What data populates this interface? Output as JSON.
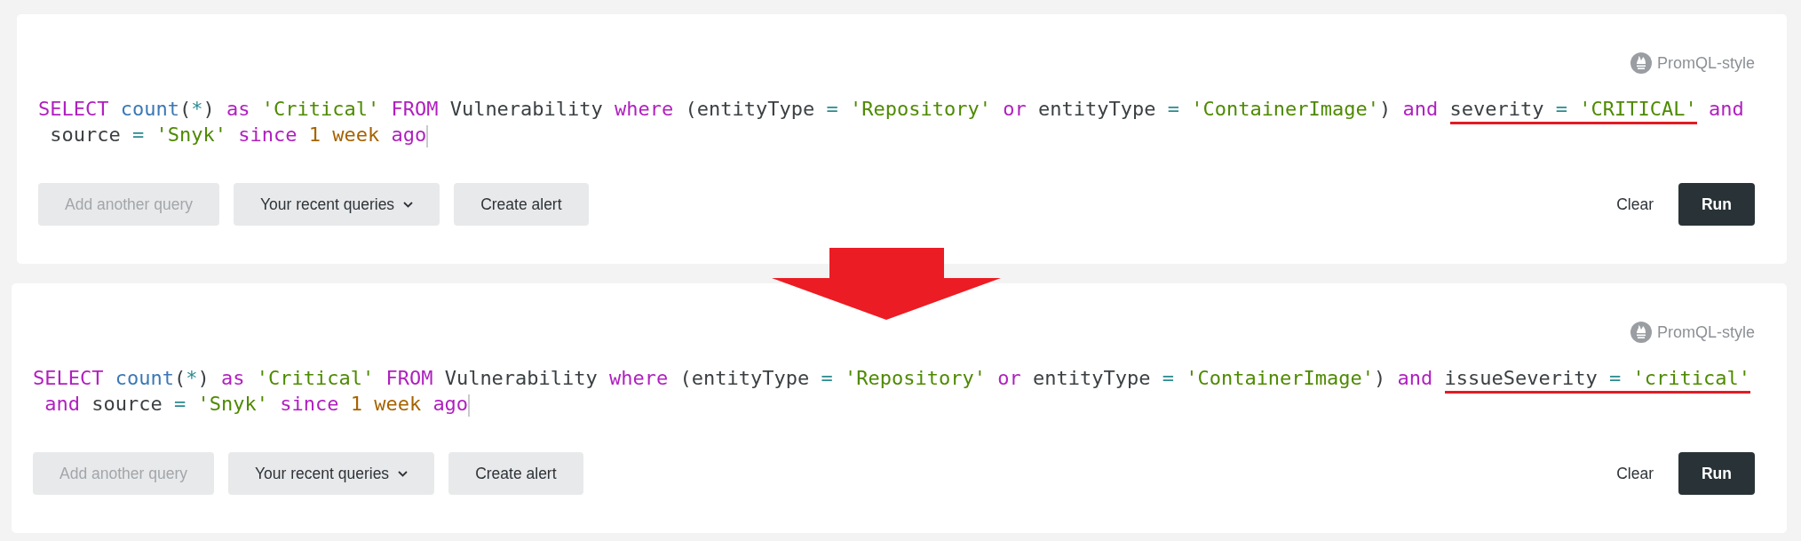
{
  "panels": [
    {
      "badge": "PromQL-style",
      "query_lines": [
        [
          {
            "kind": "keyword",
            "text": "SELECT ",
            "underlined": false
          },
          {
            "kind": "function",
            "text": "count",
            "underlined": false
          },
          {
            "kind": "plain",
            "text": "(",
            "underlined": false
          },
          {
            "kind": "operator",
            "text": "*",
            "underlined": false
          },
          {
            "kind": "plain",
            "text": ") ",
            "underlined": false
          },
          {
            "kind": "keyword",
            "text": "as ",
            "underlined": false
          },
          {
            "kind": "string",
            "text": "'Critical' ",
            "underlined": false
          },
          {
            "kind": "keyword",
            "text": "FROM ",
            "underlined": false
          },
          {
            "kind": "plain",
            "text": "Vulnerability ",
            "underlined": false
          },
          {
            "kind": "keyword",
            "text": "where ",
            "underlined": false
          },
          {
            "kind": "plain",
            "text": "(entityType ",
            "underlined": false
          },
          {
            "kind": "operator",
            "text": "= ",
            "underlined": false
          },
          {
            "kind": "string",
            "text": "'Repository' ",
            "underlined": false
          },
          {
            "kind": "keyword",
            "text": "or ",
            "underlined": false
          },
          {
            "kind": "plain",
            "text": "entityType ",
            "underlined": false
          },
          {
            "kind": "operator",
            "text": "= ",
            "underlined": false
          },
          {
            "kind": "string",
            "text": "'ContainerImage'",
            "underlined": false
          },
          {
            "kind": "plain",
            "text": ") ",
            "underlined": false
          },
          {
            "kind": "keyword",
            "text": "and ",
            "underlined": false
          },
          {
            "kind": "plain",
            "text": "severity ",
            "underlined": true
          },
          {
            "kind": "operator",
            "text": "= ",
            "underlined": true
          },
          {
            "kind": "string",
            "text": "'CRITICAL'",
            "underlined": true
          },
          {
            "kind": "keyword",
            "text": " and",
            "underlined": false
          }
        ],
        [
          {
            "kind": "plain",
            "text": " source ",
            "underlined": false
          },
          {
            "kind": "operator",
            "text": "= ",
            "underlined": false
          },
          {
            "kind": "string",
            "text": "'Snyk' ",
            "underlined": false
          },
          {
            "kind": "keyword",
            "text": "since ",
            "underlined": false
          },
          {
            "kind": "number",
            "text": "1 week ",
            "underlined": false
          },
          {
            "kind": "keyword",
            "text": "ago",
            "underlined": false
          }
        ]
      ],
      "buttons": [
        {
          "kind": "plain",
          "label": "Add another query",
          "disabled": true
        },
        {
          "kind": "dropdown",
          "label": "Your recent queries",
          "disabled": false
        },
        {
          "kind": "plain",
          "label": "Create alert",
          "disabled": false
        }
      ],
      "clear": "Clear",
      "run": "Run"
    },
    {
      "badge": "PromQL-style",
      "query_lines": [
        [
          {
            "kind": "keyword",
            "text": "SELECT ",
            "underlined": false
          },
          {
            "kind": "function",
            "text": "count",
            "underlined": false
          },
          {
            "kind": "plain",
            "text": "(",
            "underlined": false
          },
          {
            "kind": "operator",
            "text": "*",
            "underlined": false
          },
          {
            "kind": "plain",
            "text": ") ",
            "underlined": false
          },
          {
            "kind": "keyword",
            "text": "as ",
            "underlined": false
          },
          {
            "kind": "string",
            "text": "'Critical' ",
            "underlined": false
          },
          {
            "kind": "keyword",
            "text": "FROM ",
            "underlined": false
          },
          {
            "kind": "plain",
            "text": "Vulnerability ",
            "underlined": false
          },
          {
            "kind": "keyword",
            "text": "where ",
            "underlined": false
          },
          {
            "kind": "plain",
            "text": "(entityType ",
            "underlined": false
          },
          {
            "kind": "operator",
            "text": "= ",
            "underlined": false
          },
          {
            "kind": "string",
            "text": "'Repository' ",
            "underlined": false
          },
          {
            "kind": "keyword",
            "text": "or ",
            "underlined": false
          },
          {
            "kind": "plain",
            "text": "entityType ",
            "underlined": false
          },
          {
            "kind": "operator",
            "text": "= ",
            "underlined": false
          },
          {
            "kind": "string",
            "text": "'ContainerImage'",
            "underlined": false
          },
          {
            "kind": "plain",
            "text": ") ",
            "underlined": false
          },
          {
            "kind": "keyword",
            "text": "and ",
            "underlined": false
          },
          {
            "kind": "plain",
            "text": "issueSeverity ",
            "underlined": true
          },
          {
            "kind": "operator",
            "text": "= ",
            "underlined": true
          },
          {
            "kind": "string",
            "text": "'critical'",
            "underlined": true
          }
        ],
        [
          {
            "kind": "keyword",
            "text": " and ",
            "underlined": false
          },
          {
            "kind": "plain",
            "text": "source ",
            "underlined": false
          },
          {
            "kind": "operator",
            "text": "= ",
            "underlined": false
          },
          {
            "kind": "string",
            "text": "'Snyk' ",
            "underlined": false
          },
          {
            "kind": "keyword",
            "text": "since ",
            "underlined": false
          },
          {
            "kind": "number",
            "text": "1 week ",
            "underlined": false
          },
          {
            "kind": "keyword",
            "text": "ago",
            "underlined": false
          }
        ]
      ],
      "buttons": [
        {
          "kind": "plain",
          "label": "Add another query",
          "disabled": true
        },
        {
          "kind": "dropdown",
          "label": "Your recent queries",
          "disabled": false
        },
        {
          "kind": "plain",
          "label": "Create alert",
          "disabled": false
        }
      ],
      "clear": "Clear",
      "run": "Run"
    }
  ]
}
